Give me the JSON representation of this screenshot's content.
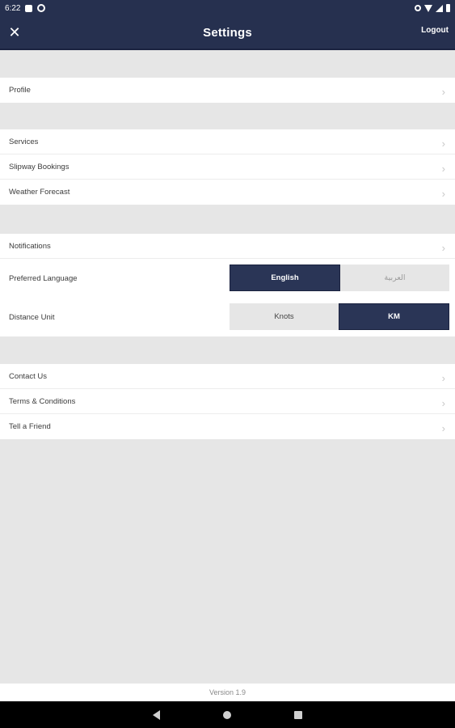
{
  "status_bar": {
    "time": "6:22"
  },
  "app_bar": {
    "title": "Settings",
    "close_label": "✕",
    "logout_label": "Logout"
  },
  "groups": {
    "account": [
      {
        "label": "Profile"
      }
    ],
    "services": [
      {
        "label": "Services"
      },
      {
        "label": "Slipway Bookings"
      },
      {
        "label": "Weather Forecast"
      }
    ],
    "preferences": {
      "notifications": "Notifications",
      "language": {
        "label": "Preferred Language",
        "options": [
          "English",
          "العربية"
        ],
        "selected": "English"
      },
      "distance": {
        "label": "Distance Unit",
        "options": [
          "Knots",
          "KM"
        ],
        "selected": "KM"
      }
    },
    "about": [
      {
        "label": "Contact Us"
      },
      {
        "label": "Terms & Conditions"
      },
      {
        "label": "Tell a Friend"
      }
    ]
  },
  "chevron_glyph": "›",
  "footer": {
    "version": "Version 1.9"
  },
  "colors": {
    "primary": "#26304f",
    "background": "#e6e6e6",
    "row": "#ffffff"
  },
  "icons": [
    "close-icon",
    "chevron-right-icon",
    "wifi-icon",
    "signal-icon",
    "battery-icon",
    "location-icon",
    "nav-back-icon",
    "nav-home-icon",
    "nav-recents-icon"
  ]
}
